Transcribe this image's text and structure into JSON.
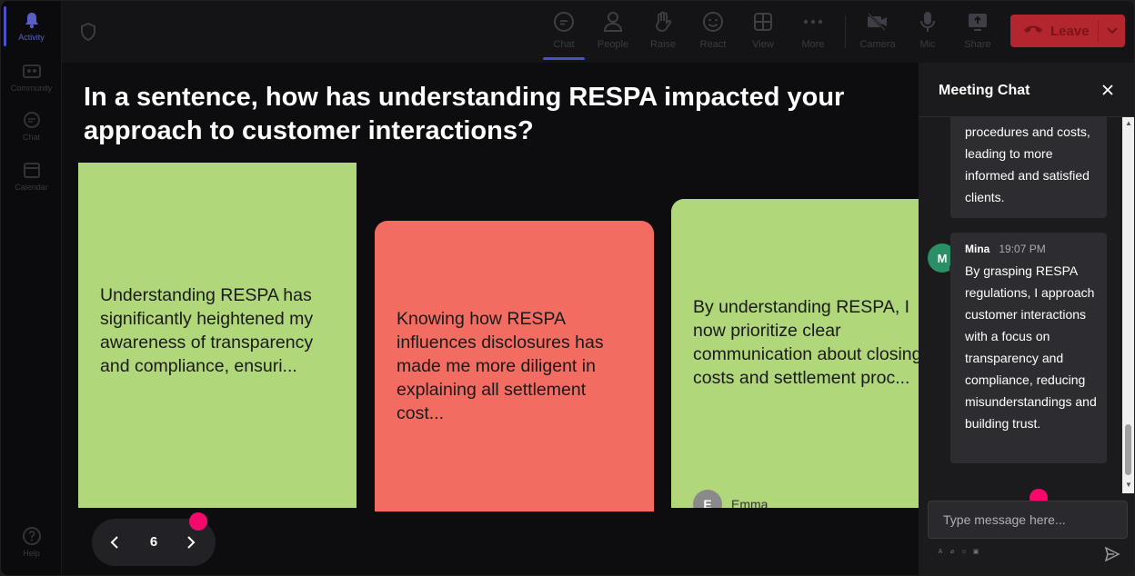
{
  "rail": {
    "items": [
      {
        "label": "Activity",
        "icon": "bell-icon",
        "active": true
      },
      {
        "label": "Community",
        "icon": "community-icon"
      },
      {
        "label": "Chat",
        "icon": "chat-icon"
      },
      {
        "label": "Calendar",
        "icon": "calendar-icon"
      },
      {
        "label": "Help",
        "icon": "help-icon"
      }
    ]
  },
  "toolbar": {
    "chat": "Chat",
    "people": "People",
    "raise": "Raise",
    "react": "React",
    "view": "View",
    "more": "More",
    "camera": "Camera",
    "mic": "Mic",
    "share": "Share",
    "leave": "Leave"
  },
  "stage": {
    "question": "In a sentence, how has understanding RESPA impacted your approach to customer interactions?",
    "cards": [
      {
        "color": "#b1d77b",
        "text": "Understanding RESPA has significantly heightened my awareness of transparency and compliance, ensuri..."
      },
      {
        "color": "#f26c61",
        "text": "Knowing how RESPA influences disclosures has made me more diligent in explaining all settlement cost..."
      },
      {
        "color": "#b1d77b",
        "text": "By understanding RESPA, I now prioritize clear communication about closing costs and settlement proc...",
        "author_initial": "E",
        "author_name": "Emma"
      }
    ],
    "page": "6"
  },
  "chat": {
    "title": "Meeting Chat",
    "messages": [
      {
        "text": "procedures and costs, leading to more informed and satisfied clients."
      },
      {
        "sender": "Mina",
        "initial": "M",
        "time": "19:07 PM",
        "text": "By grasping RESPA regulations, I approach customer interactions with a focus on transparency and compliance, reducing misunderstandings and building trust."
      }
    ],
    "input_placeholder": "Type message here..."
  },
  "colors": {
    "leave": "#b3262d",
    "accent": "#4b50c4",
    "card_green": "#b1d77b",
    "card_red": "#f26c61",
    "avatar_mina": "#2a8f65",
    "marker": "#f5096a"
  }
}
